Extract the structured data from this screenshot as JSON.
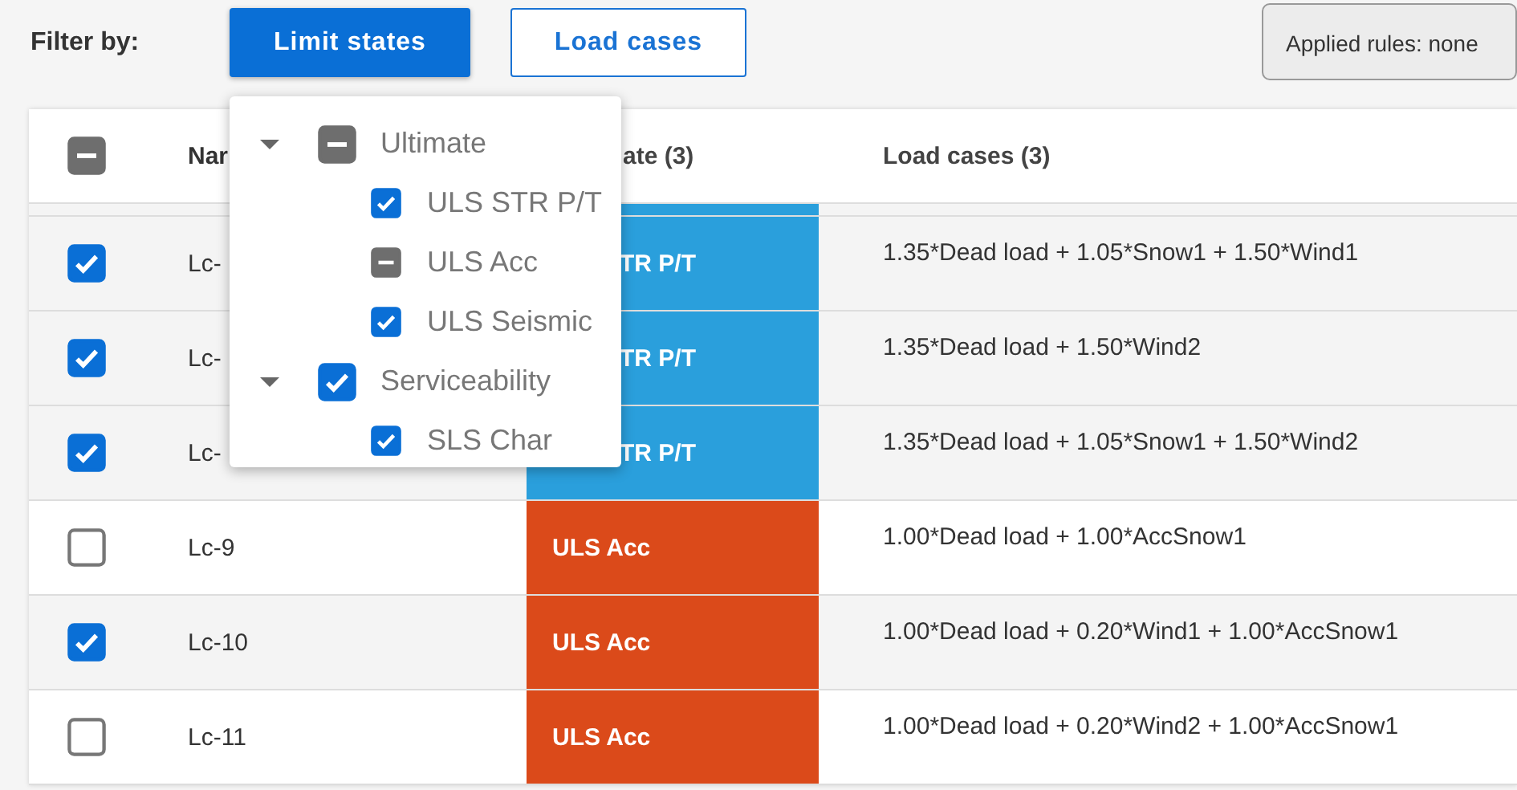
{
  "filter": {
    "label": "Filter by:",
    "buttons": [
      {
        "label": "Limit states",
        "selected": true
      },
      {
        "label": "Load cases",
        "selected": false
      }
    ],
    "applied_rules": "Applied rules: none"
  },
  "table": {
    "header": {
      "checked": false,
      "indeterminate": true,
      "columns": [
        "Nar",
        "ate (3)",
        "Load cases (3)"
      ]
    },
    "rows": [
      {
        "checked": true,
        "name": "Lc-",
        "limit_state": "TR P/T",
        "kind": "str",
        "load_cases": "1.35*Dead load + 1.05*Snow1 + 1.50*Wind1"
      },
      {
        "checked": true,
        "name": "Lc-",
        "limit_state": "TR P/T",
        "kind": "str",
        "load_cases": "1.35*Dead load + 1.50*Wind2"
      },
      {
        "checked": true,
        "name": "Lc-",
        "limit_state": "TR P/T",
        "kind": "str",
        "load_cases": "1.35*Dead load + 1.05*Snow1 + 1.50*Wind2"
      },
      {
        "checked": false,
        "name": "Lc-9",
        "limit_state": "ULS Acc",
        "kind": "acc",
        "load_cases": "1.00*Dead load + 1.00*AccSnow1"
      },
      {
        "checked": true,
        "name": "Lc-10",
        "limit_state": "ULS Acc",
        "kind": "acc",
        "load_cases": "1.00*Dead load + 0.20*Wind1 + 1.00*AccSnow1"
      },
      {
        "checked": false,
        "name": "Lc-11",
        "limit_state": "ULS Acc",
        "kind": "acc",
        "load_cases": "1.00*Dead load + 0.20*Wind2 + 1.00*AccSnow1"
      }
    ]
  },
  "popup": {
    "groups": [
      {
        "label": "Ultimate",
        "expanded": true,
        "checked": false,
        "indeterminate": true,
        "children": [
          {
            "label": "ULS STR P/T",
            "checked": true,
            "indeterminate": false
          },
          {
            "label": "ULS Acc",
            "checked": false,
            "indeterminate": true
          },
          {
            "label": "ULS Seismic",
            "checked": true,
            "indeterminate": false
          }
        ]
      },
      {
        "label": "Serviceability",
        "expanded": true,
        "checked": true,
        "indeterminate": false,
        "children": [
          {
            "label": "SLS Char",
            "checked": true,
            "indeterminate": false
          }
        ]
      }
    ]
  }
}
